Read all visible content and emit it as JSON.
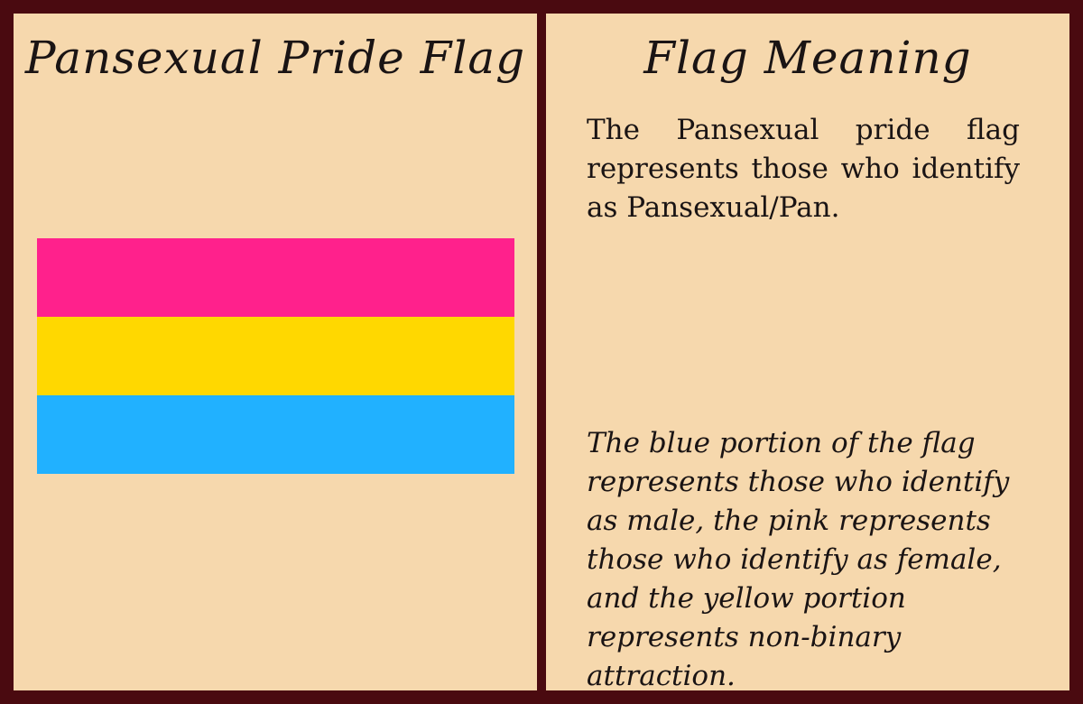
{
  "left_panel": {
    "title": "Pansexual Pride Flag",
    "flag": {
      "stripes": [
        {
          "name": "pink-stripe",
          "color": "#ff218c"
        },
        {
          "name": "yellow-stripe",
          "color": "#ffd800"
        },
        {
          "name": "blue-stripe",
          "color": "#21b1ff"
        }
      ]
    }
  },
  "right_panel": {
    "title": "Flag Meaning",
    "primary_text": "The Pansexual pride flag represents those who identify as Pansexual/Pan.",
    "detail_text": "The blue portion of the flag represents those who identify as male, the pink represents those who identify as female, and the yellow portion represents non-binary attraction."
  },
  "colors": {
    "frame": "#4a0a10",
    "panel": "#f6d8ad",
    "text": "#1a1414"
  }
}
